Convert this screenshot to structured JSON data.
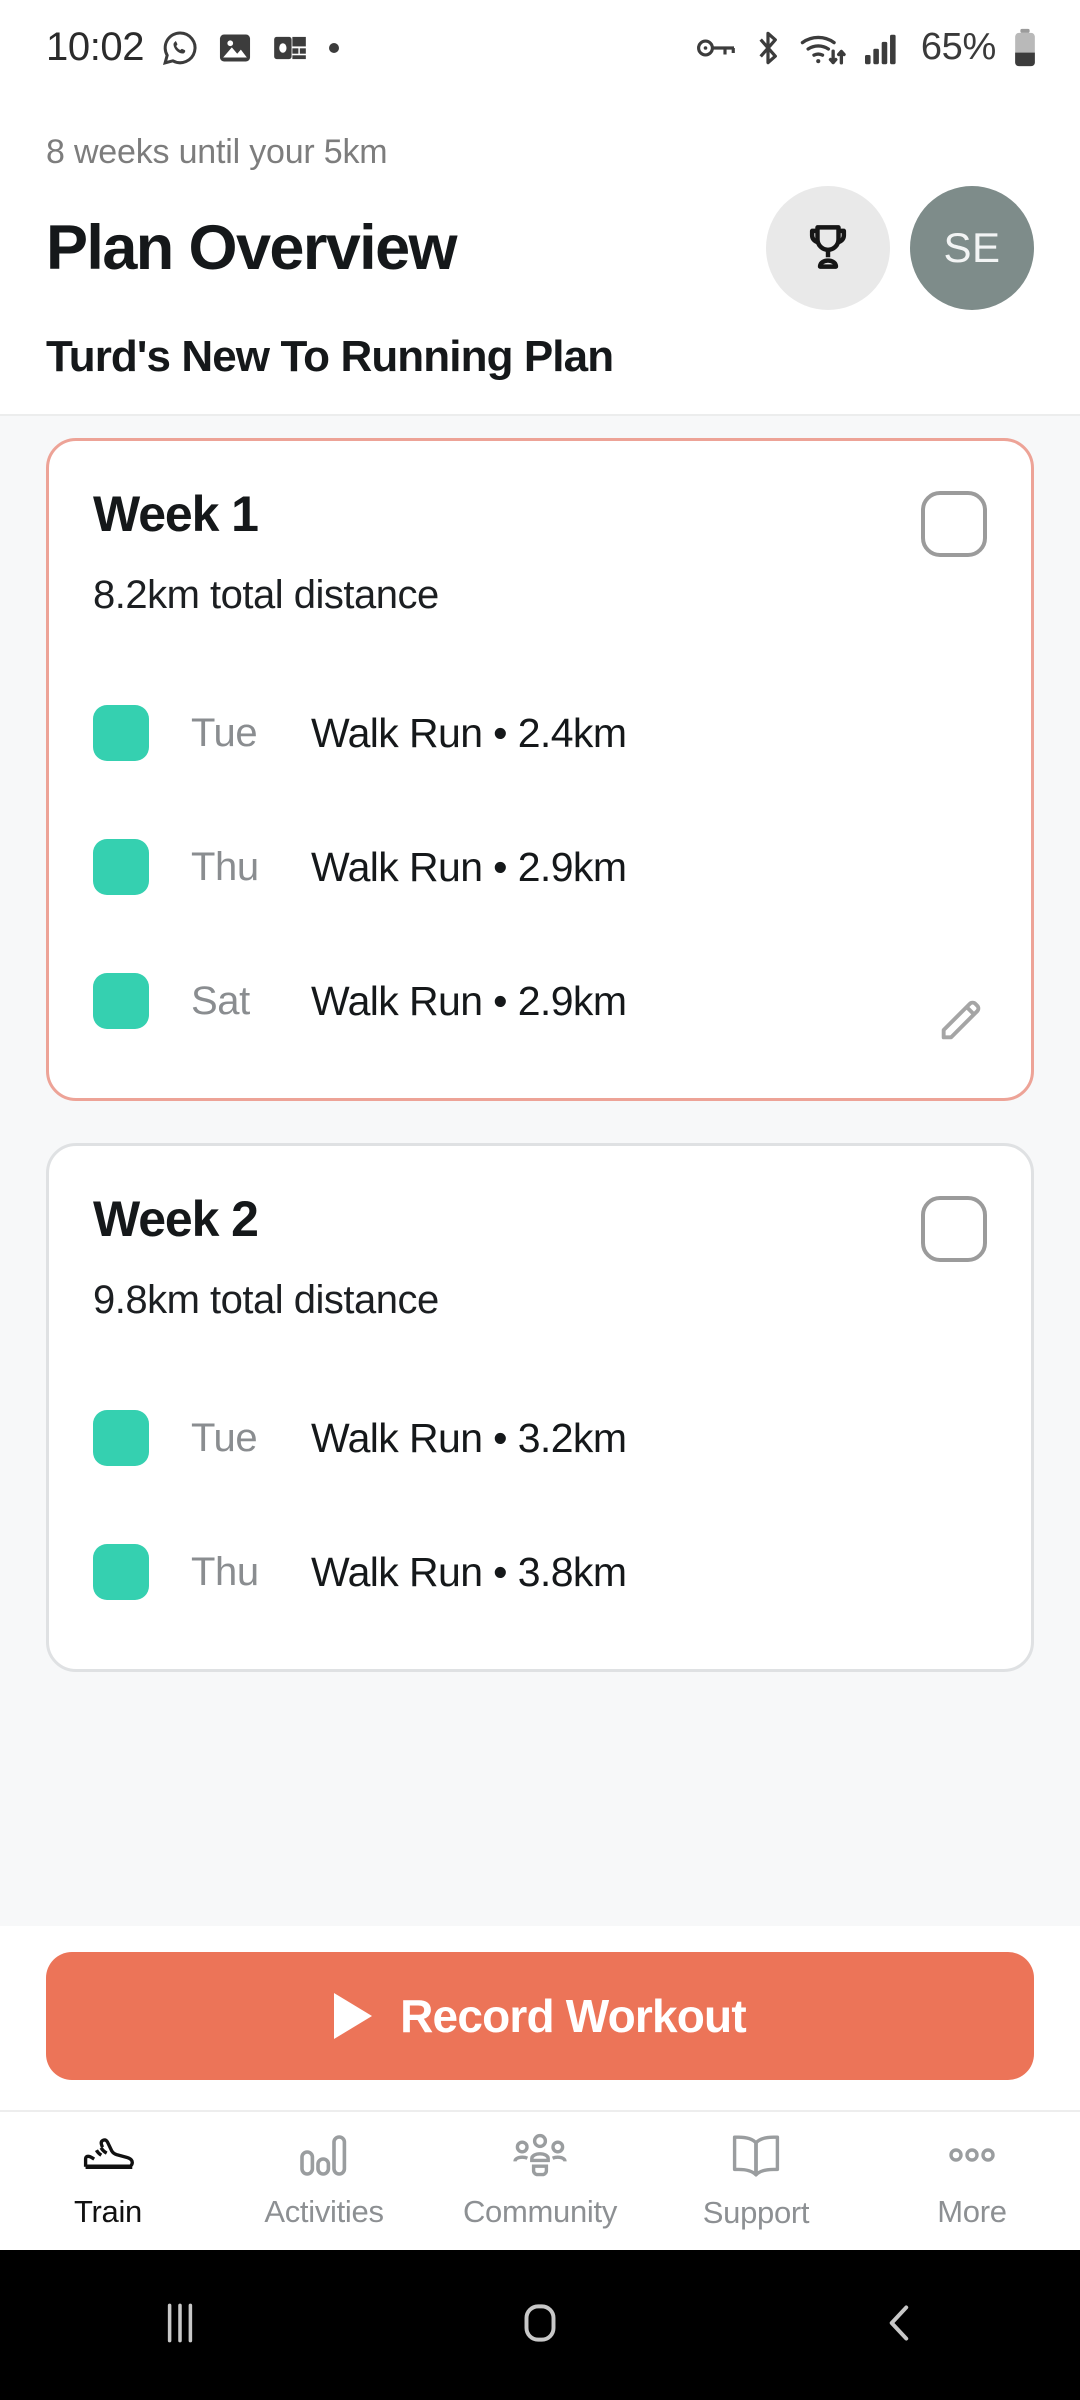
{
  "status_bar": {
    "time": "10:02",
    "left_icons": [
      "whatsapp-icon",
      "photos-icon",
      "outlook-icon",
      "dot-indicator"
    ],
    "right_icons": [
      "vpn-key-icon",
      "bluetooth-icon",
      "wifi-icon",
      "signal-icon"
    ],
    "battery_percent": "65%"
  },
  "header": {
    "eyebrow": "8 weeks until your 5km",
    "title": "Plan Overview",
    "trophy_icon": "trophy-icon",
    "avatar_initials": "SE",
    "plan_name": "Turd's New To Running Plan"
  },
  "weeks": [
    {
      "title": "Week 1",
      "total_distance": "8.2km total distance",
      "checked": false,
      "has_edit": true,
      "workouts": [
        {
          "day": "Tue",
          "description": "Walk Run • 2.4km"
        },
        {
          "day": "Thu",
          "description": "Walk Run • 2.9km"
        },
        {
          "day": "Sat",
          "description": "Walk Run • 2.9km"
        }
      ]
    },
    {
      "title": "Week 2",
      "total_distance": "9.8km total distance",
      "checked": false,
      "has_edit": false,
      "workouts": [
        {
          "day": "Tue",
          "description": "Walk Run • 3.2km"
        },
        {
          "day": "Thu",
          "description": "Walk Run • 3.8km"
        }
      ]
    }
  ],
  "record_button": {
    "label": "Record Workout",
    "icon": "play-icon"
  },
  "tabs": [
    {
      "label": "Train",
      "icon": "shoe-icon",
      "active": true
    },
    {
      "label": "Activities",
      "icon": "bar-chart-icon",
      "active": false
    },
    {
      "label": "Community",
      "icon": "people-icon",
      "active": false
    },
    {
      "label": "Support",
      "icon": "book-icon",
      "active": false
    },
    {
      "label": "More",
      "icon": "ellipsis-icon",
      "active": false
    }
  ],
  "system_nav": {
    "recents": "recents-icon",
    "home": "home-icon",
    "back": "back-icon"
  },
  "colors": {
    "accent_coral": "#ec7458",
    "accent_teal": "#35d0b0",
    "active_card_border": "#eda397",
    "avatar_bg": "#7e8c8a"
  }
}
